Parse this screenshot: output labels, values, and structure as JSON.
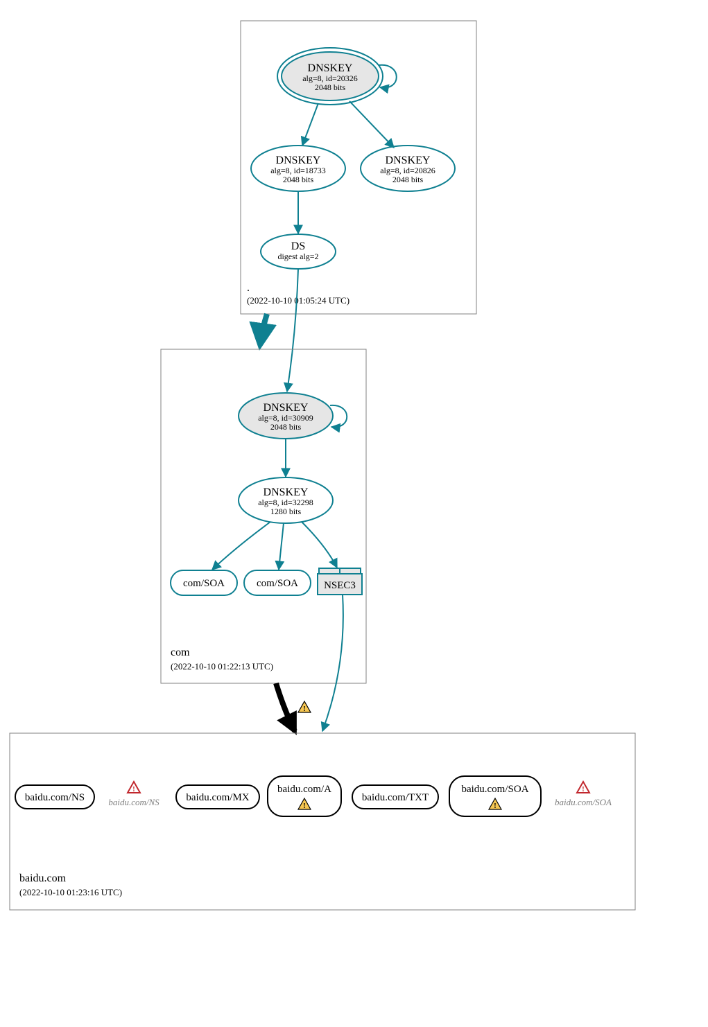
{
  "colors": {
    "teal": "#0f8091",
    "tealFill": "#e6e6e6",
    "boxStroke": "#808080",
    "nodeStroke": "#000000",
    "errorRed": "#c1272d",
    "warnYellow": "#f7c752",
    "warnStroke": "#000000"
  },
  "root": {
    "zone_label": ".",
    "timestamp": "(2022-10-10 01:05:24 UTC)",
    "ksk": {
      "title": "DNSKEY",
      "line1": "alg=8, id=20326",
      "line2": "2048 bits"
    },
    "zsk1": {
      "title": "DNSKEY",
      "line1": "alg=8, id=18733",
      "line2": "2048 bits"
    },
    "zsk2": {
      "title": "DNSKEY",
      "line1": "alg=8, id=20826",
      "line2": "2048 bits"
    },
    "ds": {
      "title": "DS",
      "line1": "digest alg=2"
    }
  },
  "com": {
    "zone_label": "com",
    "timestamp": "(2022-10-10 01:22:13 UTC)",
    "ksk": {
      "title": "DNSKEY",
      "line1": "alg=8, id=30909",
      "line2": "2048 bits"
    },
    "zsk": {
      "title": "DNSKEY",
      "line1": "alg=8, id=32298",
      "line2": "1280 bits"
    },
    "soa1": "com/SOA",
    "soa2": "com/SOA",
    "nsec3": "NSEC3"
  },
  "baidu": {
    "zone_label": "baidu.com",
    "timestamp": "(2022-10-10 01:23:16 UTC)",
    "recs": {
      "ns": "baidu.com/NS",
      "ns_err": "baidu.com/NS",
      "mx": "baidu.com/MX",
      "a": "baidu.com/A",
      "txt": "baidu.com/TXT",
      "soa": "baidu.com/SOA",
      "soa_err": "baidu.com/SOA"
    }
  }
}
